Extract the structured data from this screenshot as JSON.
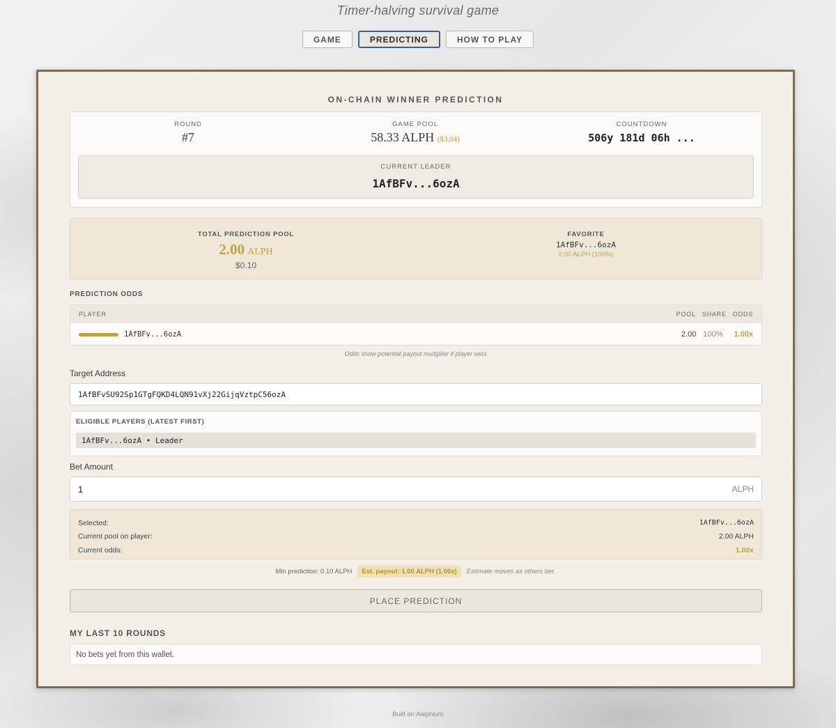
{
  "header": {
    "subtitle": "Timer-halving survival game",
    "tabs": [
      {
        "label": "GAME"
      },
      {
        "label": "PREDICTING"
      },
      {
        "label": "HOW TO PLAY"
      }
    ],
    "active_tab": "PREDICTING"
  },
  "panel": {
    "title": "ON-CHAIN WINNER PREDICTION",
    "round": {
      "label": "ROUND",
      "value": "#7"
    },
    "game_pool": {
      "label": "GAME POOL",
      "value": "58.33 ALPH",
      "usd": "($3.04)"
    },
    "countdown": {
      "label": "COUNTDOWN",
      "value": "506y 181d 06h ..."
    },
    "leader": {
      "label": "CURRENT LEADER",
      "value": "1AfBFv...6ozA"
    }
  },
  "pool": {
    "label": "TOTAL PREDICTION POOL",
    "amount": "2.00",
    "unit": "ALPH",
    "usd": "$0.10",
    "favorite": {
      "label": "FAVORITE",
      "player": "1AfBFv...6ozA",
      "detail": "2.00 ALPH (100%)"
    }
  },
  "odds": {
    "section_label": "PREDICTION ODDS",
    "headers": {
      "player": "PLAYER",
      "pool": "POOL",
      "share": "SHARE",
      "odds": "ODDS"
    },
    "rows": [
      {
        "player": "1AfBFv...6ozA",
        "pool": "2.00",
        "share": "100%",
        "odds": "1.00x",
        "bar_fraction": 1.0
      }
    ],
    "note": "Odds show potential payout multiplier if player wins"
  },
  "target": {
    "label": "Target Address",
    "value": "1AfBFvSU92Sp1GTgFQKD4LQN91vXj22GijqVztpC56ozA"
  },
  "eligible": {
    "label": "ELIGIBLE PLAYERS (LATEST FIRST)",
    "items": [
      {
        "text": "1AfBFv...6ozA • Leader"
      }
    ]
  },
  "bet": {
    "label": "Bet Amount",
    "value": "1",
    "unit": "ALPH"
  },
  "summary": {
    "selected_label": "Selected:",
    "selected_value": "1AfBFv...6ozA",
    "pool_label": "Current pool on player:",
    "pool_value": "2.00 ALPH",
    "odds_label": "Current odds:",
    "odds_value": "1.00x"
  },
  "min_line": {
    "min": "Min prediction: 0.10 ALPH",
    "est": "Est. payout: 1.00 ALPH (1.00x)",
    "note": "Estimate moves as others bet."
  },
  "place_button": "PLACE PREDICTION",
  "history": {
    "label": "MY LAST 10 ROUNDS",
    "empty": "No bets yet from this wallet."
  },
  "footer": "Built on Alephium",
  "colors": {
    "accent_gold": "#c2a240",
    "frame": "#7d6a52",
    "active_tab_border": "#3a5f8f"
  }
}
